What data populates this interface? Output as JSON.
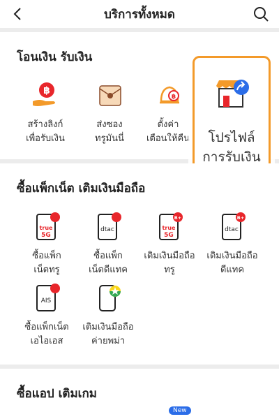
{
  "header": {
    "title": "บริการทั้งหมด"
  },
  "sections": [
    {
      "title": "โอนเงิน รับเงิน",
      "items": [
        {
          "line1": "สร้างลิงก์",
          "line2": "เพื่อรับเงิน",
          "icon": "hand-baht-icon"
        },
        {
          "line1": "ส่งซอง",
          "line2": "ทรูมันนี่",
          "icon": "envelope-icon"
        },
        {
          "line1": "ตั้งค่า",
          "line2": "เตือนให้คืน",
          "icon": "bell-baht-icon"
        }
      ]
    },
    {
      "title": "ซื้อแพ็กเน็ต เติมเงินมือถือ",
      "items": [
        {
          "line1": "ซื้อแพ็ก",
          "line2": "เน็ตทรู",
          "icon": "true-5g-sim-icon"
        },
        {
          "line1": "ซื้อแพ็ก",
          "line2": "เน็ตดีแทค",
          "icon": "dtac-sim-icon"
        },
        {
          "line1": "เติมเงินมือถือ",
          "line2": "ทรู",
          "icon": "true-topup-icon"
        },
        {
          "line1": "เติมเงินมือถือ",
          "line2": "ดีแทค",
          "icon": "dtac-topup-icon"
        },
        {
          "line1": "ซื้อแพ็กเน็ต",
          "line2": "เอไอเอส",
          "icon": "ais-sim-icon"
        },
        {
          "line1": "เติมเงินมือถือ",
          "line2": "ค่ายพม่า",
          "icon": "myanmar-topup-icon"
        }
      ]
    },
    {
      "title": "ซื้อแอป เติมเกม",
      "items": []
    }
  ],
  "promo": {
    "line1": "โปรไฟล์",
    "line2": "การรับเงิน",
    "icon": "storefront-share-icon"
  },
  "badges": {
    "new": "New"
  },
  "icons": {
    "sim": {
      "true": "true",
      "fiveg": "5G",
      "dtac": "dtac",
      "ais": "AIS",
      "plus": "B+"
    }
  },
  "colors": {
    "accent": "#f39a2a",
    "red": "#e8262b",
    "brand_blue": "#2b6de8"
  }
}
